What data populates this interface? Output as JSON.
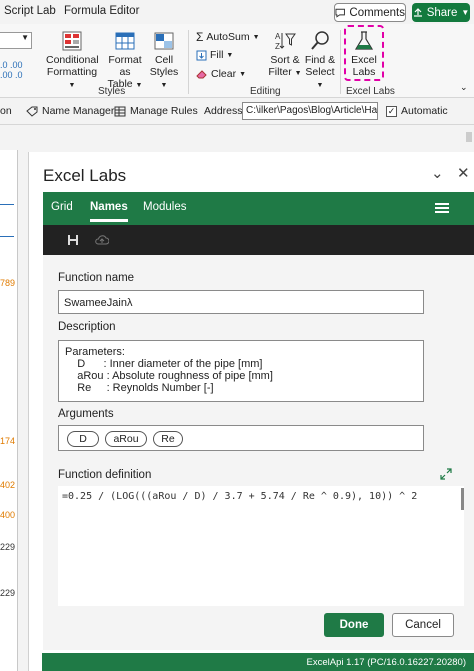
{
  "ribbon": {
    "tabs": [
      "Script Lab",
      "Formula Editor"
    ],
    "comments_label": "Comments",
    "share_label": "Share",
    "buttons": {
      "conditional_formatting": [
        "Conditional",
        "Formatting"
      ],
      "format_as_table": [
        "Format as",
        "Table"
      ],
      "cell_styles": [
        "Cell",
        "Styles"
      ],
      "autosum": "AutoSum",
      "fill": "Fill",
      "clear": "Clear",
      "sort_filter": [
        "Sort &",
        "Filter"
      ],
      "find_select": [
        "Find &",
        "Select"
      ],
      "excel_labs": [
        "Excel",
        "Labs"
      ]
    },
    "groups": [
      "Styles",
      "Editing",
      "Excel Labs"
    ]
  },
  "address_row": {
    "cut_text": "on",
    "name_manager": "Name Manager",
    "manage_rules": "Manage Rules",
    "address_label": "Address:",
    "address_value": "C:\\ilker\\Pagos\\Blog\\Article\\Har",
    "automatic_label": "Automatic"
  },
  "sheet": {
    "values": [
      "789",
      "174",
      "402",
      "400",
      "229",
      "229"
    ]
  },
  "pane": {
    "title": "Excel Labs",
    "nav": [
      "Grid",
      "Names",
      "Modules"
    ],
    "active_tab": "Names",
    "function_name_label": "Function name",
    "function_name_value": "SwameeJainλ",
    "description_label": "Description",
    "description_lines": [
      "Parameters:",
      "    D      : Inner diameter of the pipe [mm]",
      "    aRou : Absolute roughness of pipe [mm]",
      "    Re     : Reynolds Number [-]"
    ],
    "arguments_label": "Arguments",
    "arguments": [
      "D",
      "aRou",
      "Re"
    ],
    "definition_label": "Function definition",
    "definition_code": "=0.25 / (LOG(((aRou / D) / 3.7 + 5.74 / Re ^ 0.9), 10)) ^ 2",
    "done_label": "Done",
    "cancel_label": "Cancel",
    "status_text": "ExcelApi 1.17 (PC/16.0.16227.20280)"
  },
  "colors": {
    "brand_green": "#1f7a46",
    "highlight_magenta": "#e200a8"
  }
}
